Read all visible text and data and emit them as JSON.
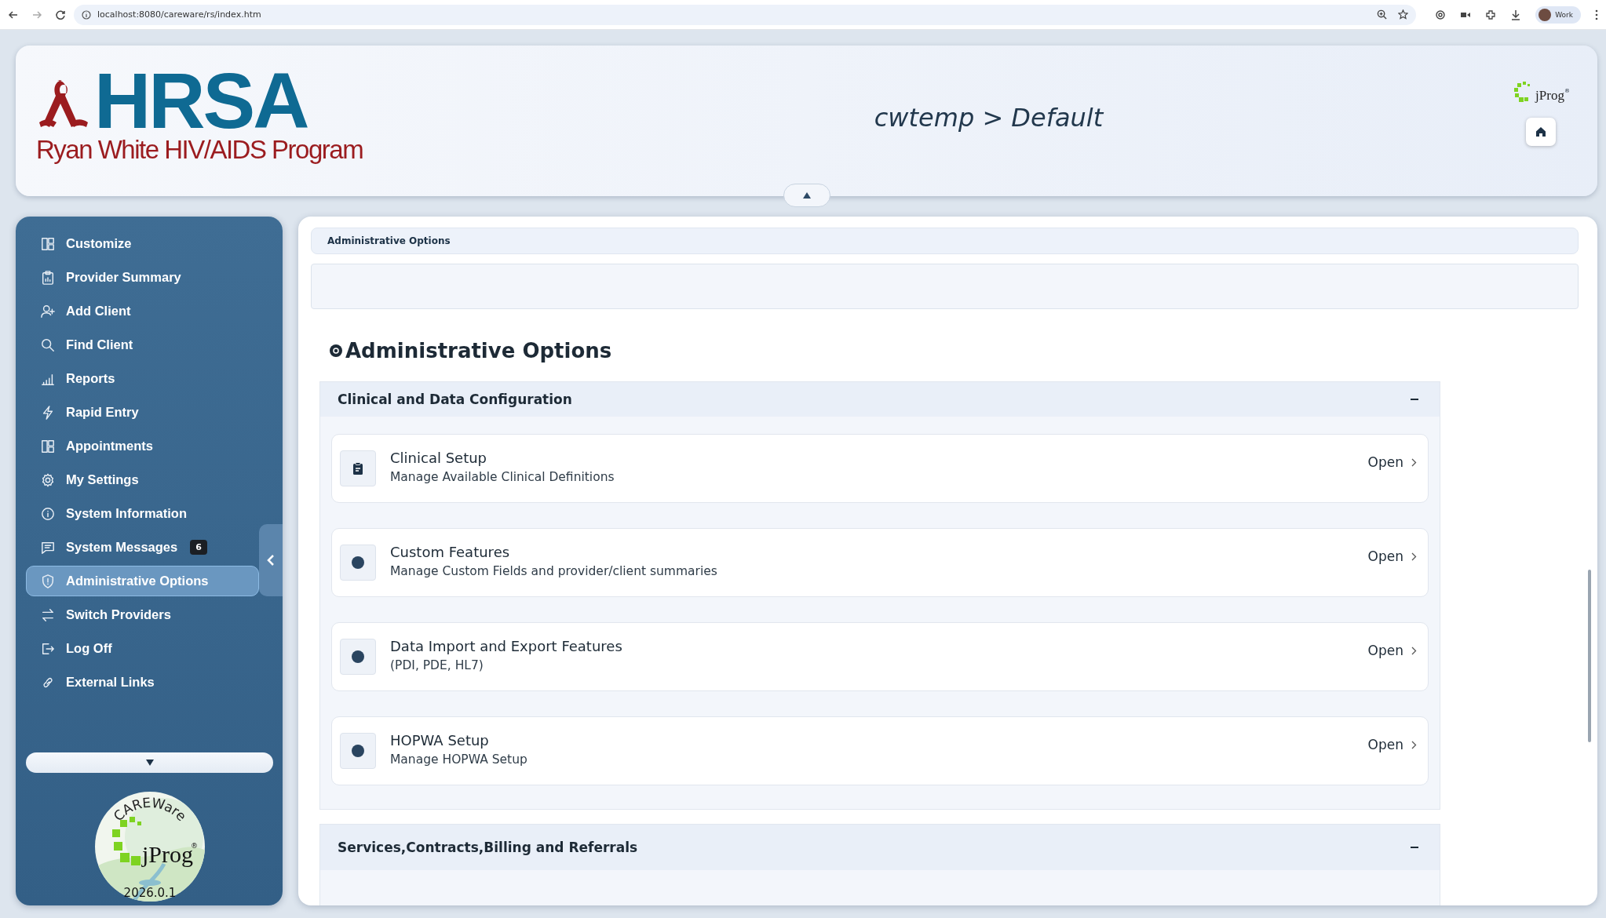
{
  "browser": {
    "url": "localhost:8080/careware/rs/index.htm",
    "profile": "Work"
  },
  "header": {
    "logo": {
      "mark": "HRSA",
      "subtitle": "Ryan White HIV/AIDS Program"
    },
    "title": "cwtemp > Default",
    "brand": {
      "name": "jProg",
      "mark": "®"
    }
  },
  "sidebar": {
    "items": [
      {
        "label": "Customize",
        "selected": false
      },
      {
        "label": "Provider Summary",
        "selected": false
      },
      {
        "label": "Add Client",
        "selected": false
      },
      {
        "label": "Find Client",
        "selected": false
      },
      {
        "label": "Reports",
        "selected": false
      },
      {
        "label": "Rapid Entry",
        "selected": false
      },
      {
        "label": "Appointments",
        "selected": false
      },
      {
        "label": "My Settings",
        "selected": false
      },
      {
        "label": "System Information",
        "selected": false
      },
      {
        "label": "System Messages",
        "selected": false,
        "badge": "6"
      },
      {
        "label": "Administrative Options",
        "selected": true
      },
      {
        "label": "Switch Providers",
        "selected": false
      },
      {
        "label": "Log Off",
        "selected": false
      },
      {
        "label": "External Links",
        "selected": false
      }
    ],
    "badge_logo": {
      "top": "CAREWare",
      "name": "jProg",
      "mark": "®",
      "version": "2026.0.1"
    }
  },
  "breadcrumb": "Administrative Options",
  "page_title": "Administrative Options",
  "sections": [
    {
      "title": "Clinical and Data Configuration",
      "expanded": true,
      "items": [
        {
          "kind": "clipboard",
          "title": "Clinical Setup",
          "description": "Manage Available Clinical Definitions",
          "action": "Open"
        },
        {
          "kind": "dot",
          "title": "Custom Features",
          "description": "Manage Custom Fields and provider/client summaries",
          "action": "Open"
        },
        {
          "kind": "dot",
          "title": "Data Import and Export Features",
          "description": "(PDI, PDE, HL7)",
          "action": "Open"
        },
        {
          "kind": "dot",
          "title": "HOPWA Setup",
          "description": "Manage HOPWA Setup",
          "action": "Open"
        }
      ]
    },
    {
      "title": "Services,Contracts,Billing and Referrals",
      "expanded": true
    }
  ]
}
